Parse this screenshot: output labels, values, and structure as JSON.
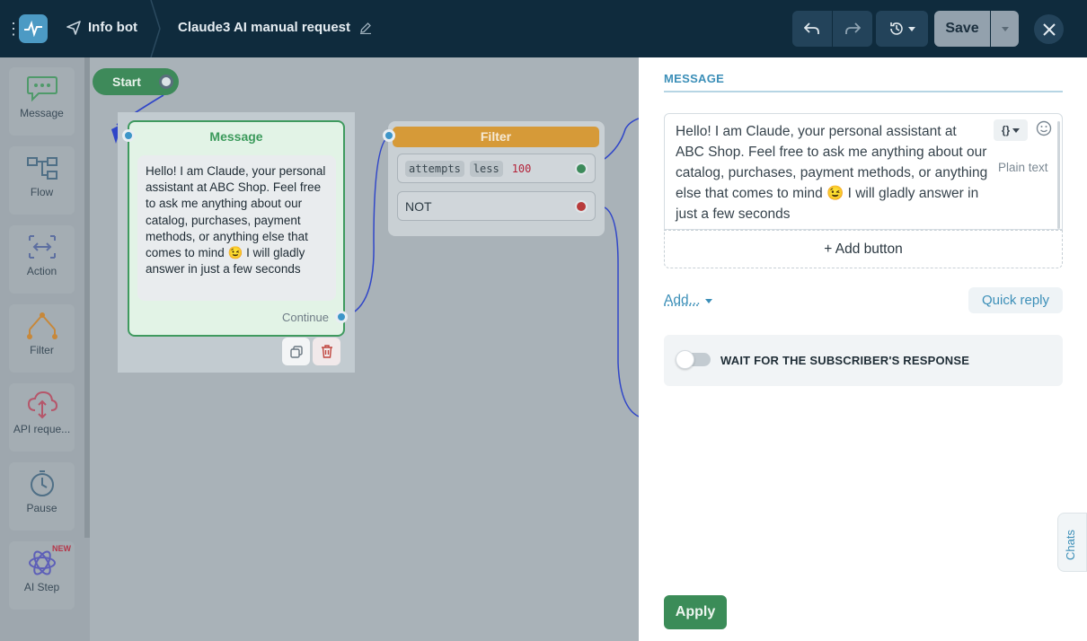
{
  "header": {
    "bot_name": "Info bot",
    "flow_title": "Claude3 AI manual request",
    "save_label": "Save"
  },
  "sidebar": {
    "items": [
      {
        "label": "Message",
        "icon": "message-icon"
      },
      {
        "label": "Flow",
        "icon": "flow-icon"
      },
      {
        "label": "Action",
        "icon": "action-icon"
      },
      {
        "label": "Filter",
        "icon": "filter-icon"
      },
      {
        "label": "API reque...",
        "icon": "api-request-icon"
      },
      {
        "label": "Pause",
        "icon": "clock-icon"
      },
      {
        "label": "AI Step",
        "icon": "ai-step-icon",
        "badge": "NEW"
      }
    ]
  },
  "canvas": {
    "start_label": "Start",
    "message_node": {
      "title": "Message",
      "text": "Hello! I am Claude, your personal assistant at ABC Shop. Feel free to ask me anything about our catalog, purchases, payment methods, or anything else that comes to mind 😉 I will gladly answer in just a few seconds",
      "continue_label": "Continue"
    },
    "filter_node": {
      "title": "Filter",
      "condition": {
        "field": "attempts",
        "operator": "less",
        "value": "100"
      },
      "not_label": "NOT"
    }
  },
  "panel": {
    "tab_label": "MESSAGE",
    "message_text": "Hello! I am Claude, your personal assistant at ABC Shop. Feel free to ask me anything about our catalog, purchases, payment methods, or anything else that comes to mind 😉 I will gladly answer in just a few seconds",
    "variable_button": "{}",
    "format_label": "Plain text",
    "add_button_label": "+ Add button",
    "add_menu_label": "Add...",
    "quick_reply_label": "Quick reply",
    "wait_label": "WAIT FOR THE SUBSCRIBER'S RESPONSE",
    "wait_enabled": false,
    "chats_label": "Chats",
    "apply_label": "Apply"
  },
  "colors": {
    "topbar": "#0f2b3d",
    "accent_green": "#3b8c58",
    "accent_blue": "#3c8fb8",
    "filter_orange": "#d69a38"
  }
}
